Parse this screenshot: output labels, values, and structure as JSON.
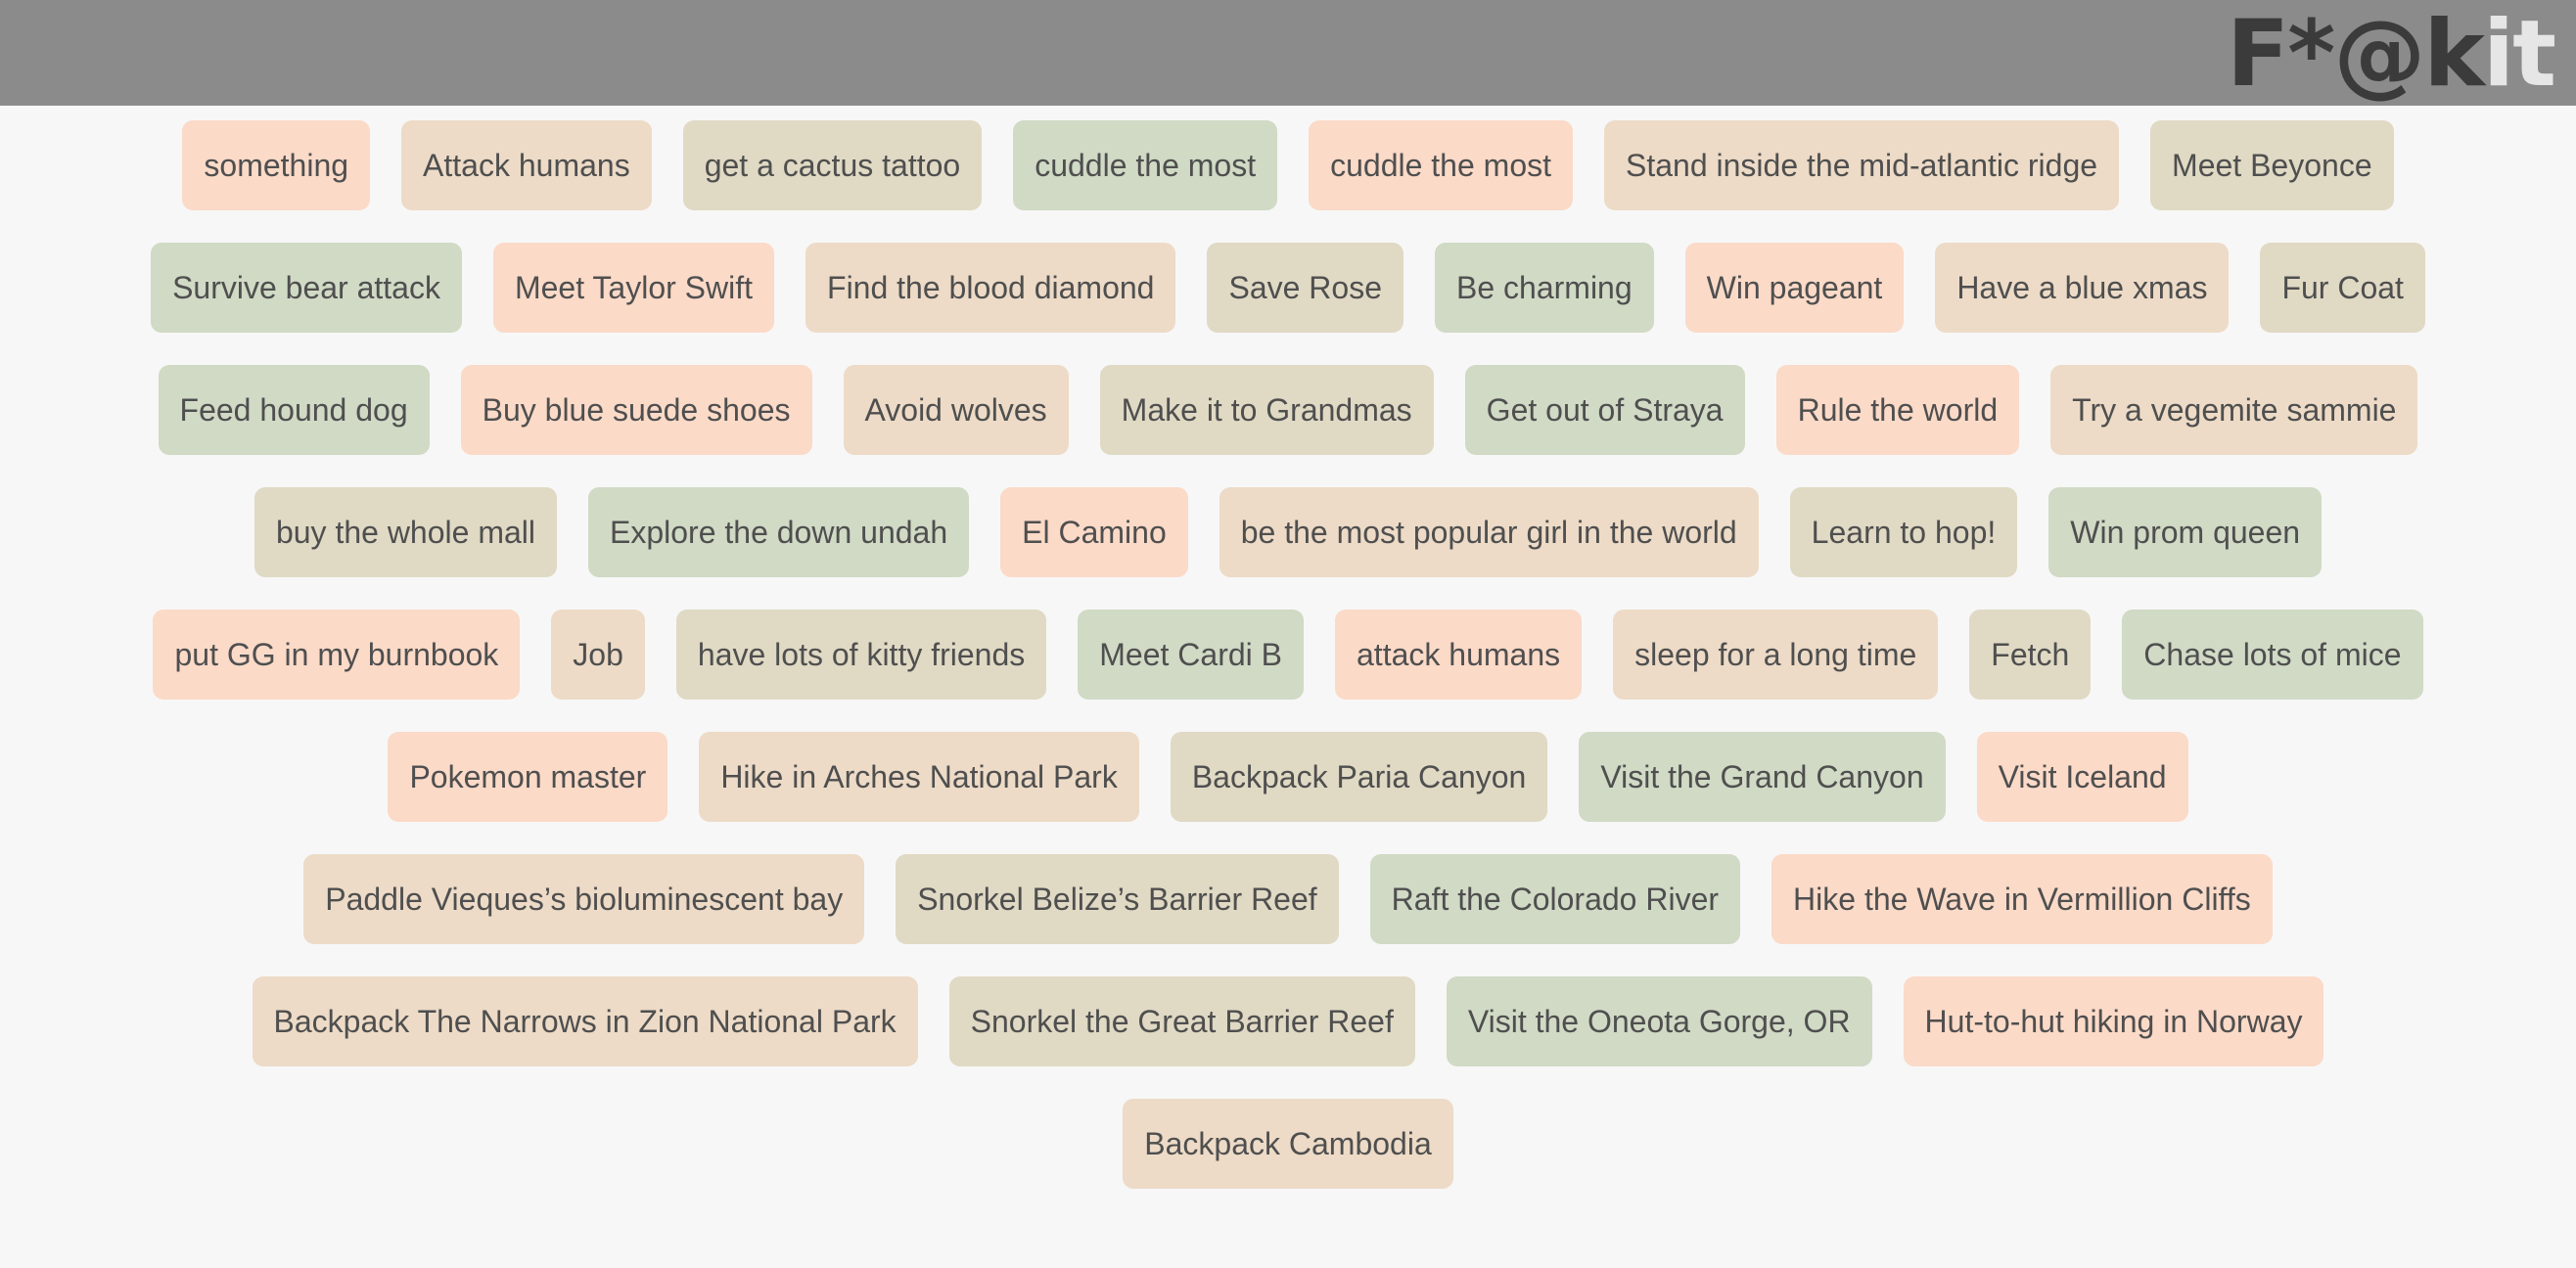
{
  "logo": {
    "dark_text": "F*@k",
    "light_text": "it"
  },
  "colors": {
    "header": "#8b8b8b",
    "background": "#f7f7f7",
    "peach": "#fbdac8",
    "tan": "#eddbc7",
    "beige": "#e0d9c4",
    "sage": "#d0dac5"
  },
  "rows": [
    [
      {
        "label": "something",
        "c": 0
      },
      {
        "label": "Attack humans",
        "c": 1
      },
      {
        "label": "get a cactus tattoo",
        "c": 2
      },
      {
        "label": "cuddle the most",
        "c": 3
      },
      {
        "label": "cuddle the most",
        "c": 0
      },
      {
        "label": "Stand inside the mid-atlantic ridge",
        "c": 1
      },
      {
        "label": "Meet Beyonce",
        "c": 2
      }
    ],
    [
      {
        "label": "Survive bear attack",
        "c": 3
      },
      {
        "label": "Meet Taylor Swift",
        "c": 0
      },
      {
        "label": "Find the blood diamond",
        "c": 1
      },
      {
        "label": "Save Rose",
        "c": 2
      },
      {
        "label": "Be charming",
        "c": 3
      },
      {
        "label": "Win pageant",
        "c": 0
      },
      {
        "label": "Have a blue xmas",
        "c": 1
      },
      {
        "label": "Fur Coat",
        "c": 2
      }
    ],
    [
      {
        "label": "Feed hound dog",
        "c": 3
      },
      {
        "label": "Buy blue suede shoes",
        "c": 0
      },
      {
        "label": "Avoid wolves",
        "c": 1
      },
      {
        "label": "Make it to Grandmas",
        "c": 2
      },
      {
        "label": "Get out of Straya",
        "c": 3
      },
      {
        "label": "Rule the world",
        "c": 0
      },
      {
        "label": "Try a vegemite sammie",
        "c": 1
      }
    ],
    [
      {
        "label": "buy the whole mall",
        "c": 2
      },
      {
        "label": "Explore the down undah",
        "c": 3
      },
      {
        "label": "El Camino",
        "c": 0
      },
      {
        "label": "be the most popular girl in the world",
        "c": 1
      },
      {
        "label": "Learn to hop!",
        "c": 2
      },
      {
        "label": "Win prom queen",
        "c": 3
      }
    ],
    [
      {
        "label": "put GG in my burnbook",
        "c": 0
      },
      {
        "label": "Job",
        "c": 1
      },
      {
        "label": "have lots of kitty friends",
        "c": 2
      },
      {
        "label": "Meet Cardi B",
        "c": 3
      },
      {
        "label": "attack humans",
        "c": 0
      },
      {
        "label": "sleep for a long time",
        "c": 1
      },
      {
        "label": "Fetch",
        "c": 2
      },
      {
        "label": "Chase lots of mice",
        "c": 3
      }
    ],
    [
      {
        "label": "Pokemon master",
        "c": 0
      },
      {
        "label": "Hike in Arches National Park",
        "c": 1
      },
      {
        "label": "Backpack Paria Canyon",
        "c": 2
      },
      {
        "label": "Visit the Grand Canyon",
        "c": 3
      },
      {
        "label": "Visit Iceland",
        "c": 0
      }
    ],
    [
      {
        "label": "Paddle Vieques’s bioluminescent bay",
        "c": 1
      },
      {
        "label": "Snorkel Belize’s Barrier Reef",
        "c": 2
      },
      {
        "label": "Raft the Colorado River",
        "c": 3
      },
      {
        "label": "Hike the Wave in Vermillion Cliffs",
        "c": 0
      }
    ],
    [
      {
        "label": "Backpack The Narrows in Zion National Park",
        "c": 1
      },
      {
        "label": "Snorkel the Great Barrier Reef",
        "c": 2
      },
      {
        "label": "Visit the Oneota Gorge, OR",
        "c": 3
      },
      {
        "label": "Hut-to-hut hiking in Norway",
        "c": 0
      }
    ],
    [
      {
        "label": "Backpack Cambodia",
        "c": 1
      }
    ]
  ]
}
